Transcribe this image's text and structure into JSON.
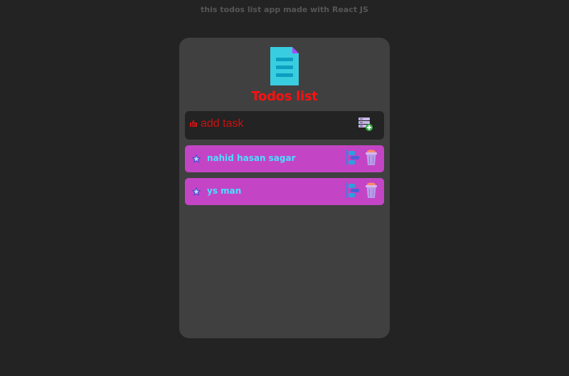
{
  "app": {
    "caption": "this todos list app made with React JS",
    "title": "Todos list"
  },
  "add_task": {
    "placeholder": "add task"
  },
  "todos": [
    {
      "label": "nahid hasan sagar"
    },
    {
      "label": "ys man"
    }
  ],
  "colors": {
    "background": "#232323",
    "card": "#404040",
    "title": "#ff1010",
    "todo_bg": "#c345c5",
    "todo_text": "#48e0ff"
  }
}
